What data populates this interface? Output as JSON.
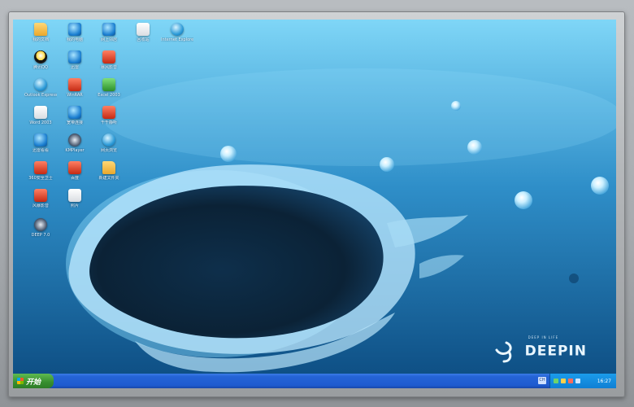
{
  "desktop": {
    "icons": [
      {
        "label": "我的文档",
        "glyph": "folder"
      },
      {
        "label": "我的电脑",
        "glyph": "blue"
      },
      {
        "label": "网上邻居",
        "glyph": "blue"
      },
      {
        "label": "回收站",
        "glyph": "doc"
      },
      {
        "label": "Internet Explorer",
        "glyph": "globe"
      },
      {
        "label": "腾讯QQ",
        "glyph": "q"
      },
      {
        "label": "迅雷",
        "glyph": "blue"
      },
      {
        "label": "暴风影音",
        "glyph": "red"
      },
      {
        "label": "Outlook Express",
        "glyph": "globe"
      },
      {
        "label": "WinRAR",
        "glyph": "red"
      },
      {
        "label": "Excel 2003",
        "glyph": "green"
      },
      {
        "label": "Word 2003",
        "glyph": "doc"
      },
      {
        "label": "宽带连接",
        "glyph": "blue"
      },
      {
        "label": "千千静听",
        "glyph": "red"
      },
      {
        "label": "迅雷看看",
        "glyph": "blue"
      },
      {
        "label": "KMPlayer",
        "glyph": "dark"
      },
      {
        "label": "网页浏览",
        "glyph": "globe"
      },
      {
        "label": "360安全卫士",
        "glyph": "red"
      },
      {
        "label": "百度",
        "glyph": "red"
      },
      {
        "label": "新建文件夹",
        "glyph": "folder"
      },
      {
        "label": "风暴影音",
        "glyph": "red"
      },
      {
        "label": "照片",
        "glyph": "doc"
      },
      {
        "label": "DEEP 7.0",
        "glyph": "dark"
      }
    ],
    "logo": {
      "tagline": "DEEP IN LIFE",
      "name": "DEEPIN"
    }
  },
  "taskbar": {
    "start_label": "开始",
    "ime_label": "CH",
    "clock": "16:27"
  },
  "colors": {
    "wallpaper_top": "#6fcff6",
    "wallpaper_bottom": "#0f4f86",
    "taskbar": "#2564d6",
    "start_button": "#378e2f"
  }
}
